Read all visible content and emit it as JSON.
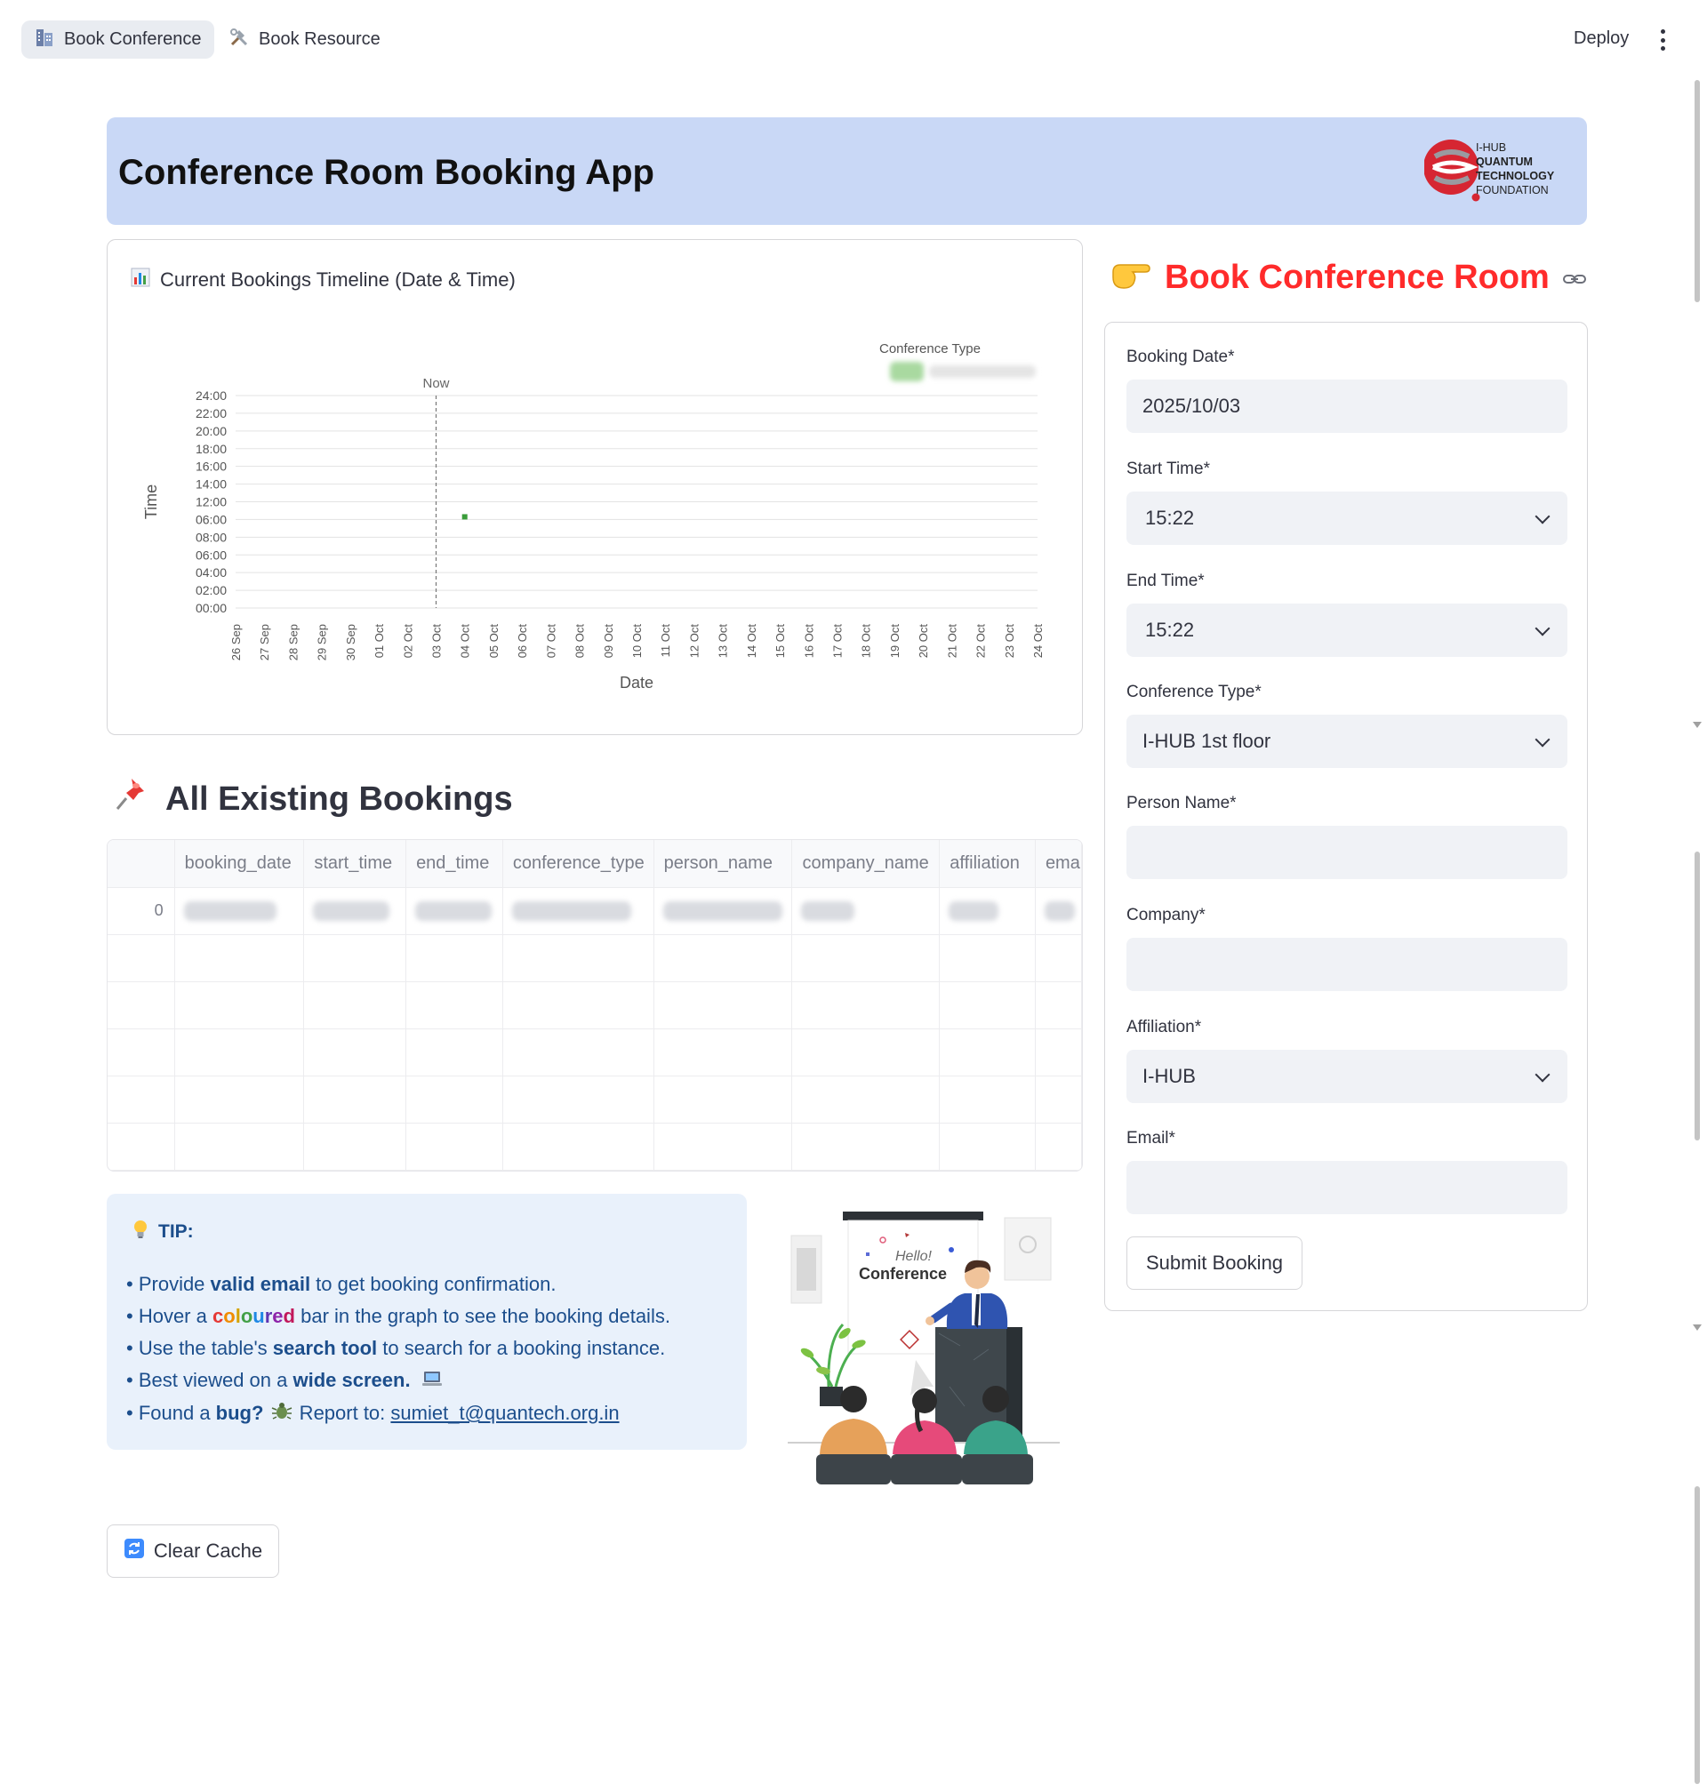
{
  "nav": {
    "tabs": [
      {
        "label": "Book Conference",
        "icon": "office-building-icon",
        "active": true
      },
      {
        "label": "Book Resource",
        "icon": "tools-icon",
        "active": false
      }
    ],
    "deploy_label": "Deploy"
  },
  "header": {
    "title": "Conference Room Booking App",
    "logo_lines": [
      "I-HUB",
      "QUANTUM",
      "TECHNOLOGY",
      "FOUNDATION"
    ]
  },
  "timeline": {
    "title": "Current Bookings Timeline (Date & Time)",
    "icon": "bar-chart-icon",
    "legend_title": "Conference Type",
    "now_label": "Now",
    "xlabel": "Date",
    "ylabel": "Time"
  },
  "chart_data": {
    "type": "bar",
    "x_categories": [
      "26 Sep",
      "27 Sep",
      "28 Sep",
      "29 Sep",
      "30 Sep",
      "01 Oct",
      "02 Oct",
      "03 Oct",
      "04 Oct",
      "05 Oct",
      "06 Oct",
      "07 Oct",
      "08 Oct",
      "09 Oct",
      "10 Oct",
      "11 Oct",
      "12 Oct",
      "13 Oct",
      "14 Oct",
      "15 Oct",
      "16 Oct",
      "17 Oct",
      "18 Oct",
      "19 Oct",
      "20 Oct",
      "21 Oct",
      "22 Oct",
      "23 Oct",
      "24 Oct"
    ],
    "y_ticks": [
      "00:00",
      "02:00",
      "04:00",
      "06:00",
      "08:00",
      "06:00",
      "12:00",
      "14:00",
      "16:00",
      "18:00",
      "20:00",
      "22:00",
      "24:00"
    ],
    "ylim_hours": [
      0,
      24
    ],
    "now_date": "03 Oct",
    "bookings": [
      {
        "date": "04 Oct",
        "start_hour": 10.0,
        "end_hour": 10.6,
        "color": "#3a9d3a"
      }
    ],
    "xlabel": "Date",
    "ylabel": "Time",
    "legend": {
      "title": "Conference Type",
      "placement": "top-right"
    },
    "grid": true
  },
  "bookings_section": {
    "title": "All Existing Bookings",
    "icon": "pushpin-icon",
    "columns": [
      "booking_date",
      "start_time",
      "end_time",
      "conference_type",
      "person_name",
      "company_name",
      "affiliation",
      "ema"
    ],
    "rows": [
      {
        "index": "0"
      }
    ]
  },
  "tip": {
    "heading": "TIP:",
    "line1_pre": "Provide ",
    "line1_bold": "valid email",
    "line1_post": " to get booking confirmation.",
    "line2_pre": "Hover a ",
    "line2_rainbow": "coloured",
    "line2_post": " bar in the graph to see the booking details.",
    "line3_pre": "Use the table's ",
    "line3_bold": "search tool",
    "line3_post": " to search for a booking instance.",
    "line4_pre": "Best viewed on a ",
    "line4_bold": "wide screen.",
    "line5_pre": "Found a ",
    "line5_bold": "bug?",
    "line5_mid": " Report to: ",
    "line5_email": "sumiet_t@quantech.org.in"
  },
  "illustration": {
    "board_text_1": "Hello!",
    "board_text_2": "Conference"
  },
  "clear_cache_label": "Clear Cache",
  "form": {
    "title": "Book Conference Room",
    "booking_date_label": "Booking Date*",
    "booking_date_value": "2025/10/03",
    "start_time_label": "Start Time*",
    "start_time_value": "15:22",
    "end_time_label": "End Time*",
    "end_time_value": "15:22",
    "conference_type_label": "Conference Type*",
    "conference_type_value": "I-HUB 1st floor",
    "person_name_label": "Person Name*",
    "person_name_value": "",
    "company_label": "Company*",
    "company_value": "",
    "affiliation_label": "Affiliation*",
    "affiliation_value": "I-HUB",
    "email_label": "Email*",
    "email_value": "",
    "submit_label": "Submit Booking"
  },
  "colors": {
    "banner_bg": "#c9d8f6",
    "form_title": "#ff2b2b",
    "tip_bg": "#e9f1fb",
    "tip_text": "#1c4e8c",
    "booking_bar": "#3a9d3a"
  }
}
